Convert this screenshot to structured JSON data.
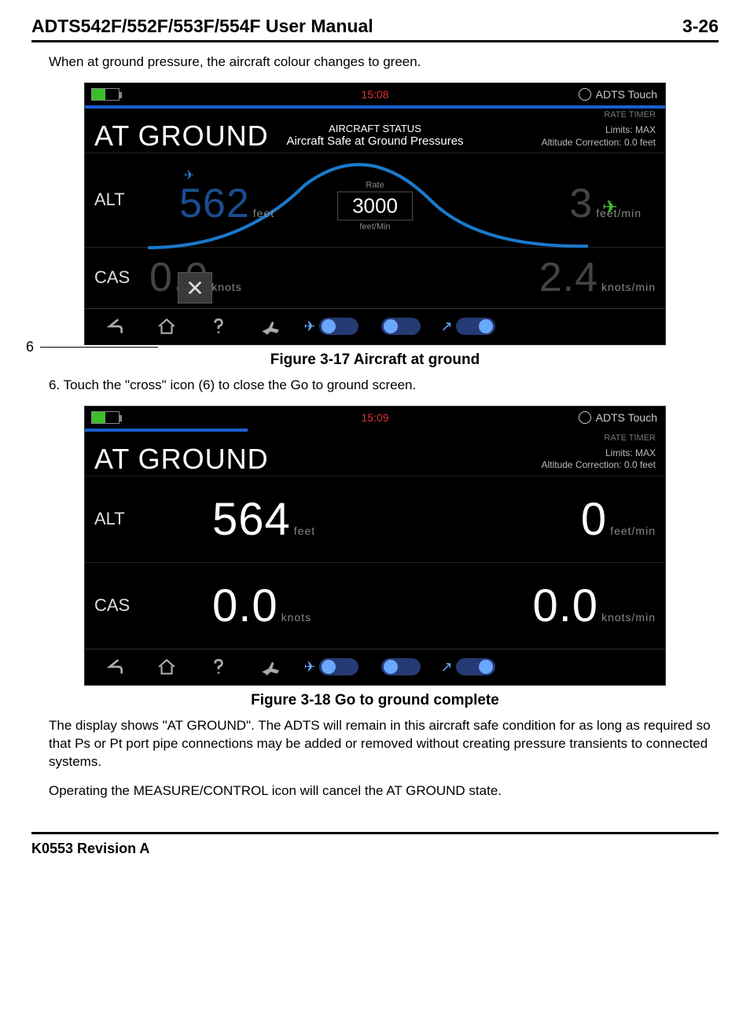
{
  "header": {
    "doc_title": "ADTS542F/552F/553F/554F User Manual",
    "page_number": "3-26"
  },
  "para1": "When at ground pressure, the aircraft colour changes to green.",
  "callout6": "6",
  "fig1": {
    "time": "15:08",
    "brand": "ADTS Touch",
    "rate_timer": "RATE TIMER",
    "limits1": "Limits: MAX",
    "limits2": "Altitude Correction: 0.0 feet",
    "at_ground": "AT GROUND",
    "status_title": "AIRCRAFT STATUS",
    "status_text": "Aircraft Safe at Ground Pressures",
    "alt_label": "ALT",
    "alt_value": "562",
    "alt_unit": "feet",
    "alt_rate_value": "3",
    "alt_rate_unit": "feet/min",
    "rate_label": "Rate",
    "rate_value": "3000",
    "rate_unit": "feet/Min",
    "cas_label": "CAS",
    "cas_value": "0.0",
    "cas_unit": "knots",
    "cas_rate_value": "2.4",
    "cas_rate_unit": "knots/min",
    "caption": "Figure 3-17 Aircraft at ground"
  },
  "para2": "6. Touch the \"cross\" icon (6) to close the Go to ground screen.",
  "fig2": {
    "time": "15:09",
    "brand": "ADTS Touch",
    "rate_timer": "RATE TIMER",
    "limits1": "Limits: MAX",
    "limits2": "Altitude Correction: 0.0 feet",
    "at_ground": "AT GROUND",
    "alt_label": "ALT",
    "alt_value": "564",
    "alt_unit": "feet",
    "alt_rate_value": "0",
    "alt_rate_unit": "feet/min",
    "cas_label": "CAS",
    "cas_value": "0.0",
    "cas_unit": "knots",
    "cas_rate_value": "0.0",
    "cas_rate_unit": "knots/min",
    "caption": "Figure 3-18 Go to ground complete"
  },
  "para3": "The display shows \"AT GROUND\". The ADTS will remain in this aircraft safe condition for as long as required so that Ps or Pt port pipe connections may be added or removed without creating pressure transients to connected systems.",
  "para4": "Operating the MEASURE/CONTROL icon will cancel the AT GROUND state.",
  "footer": {
    "rev": "K0553 Revision A"
  }
}
